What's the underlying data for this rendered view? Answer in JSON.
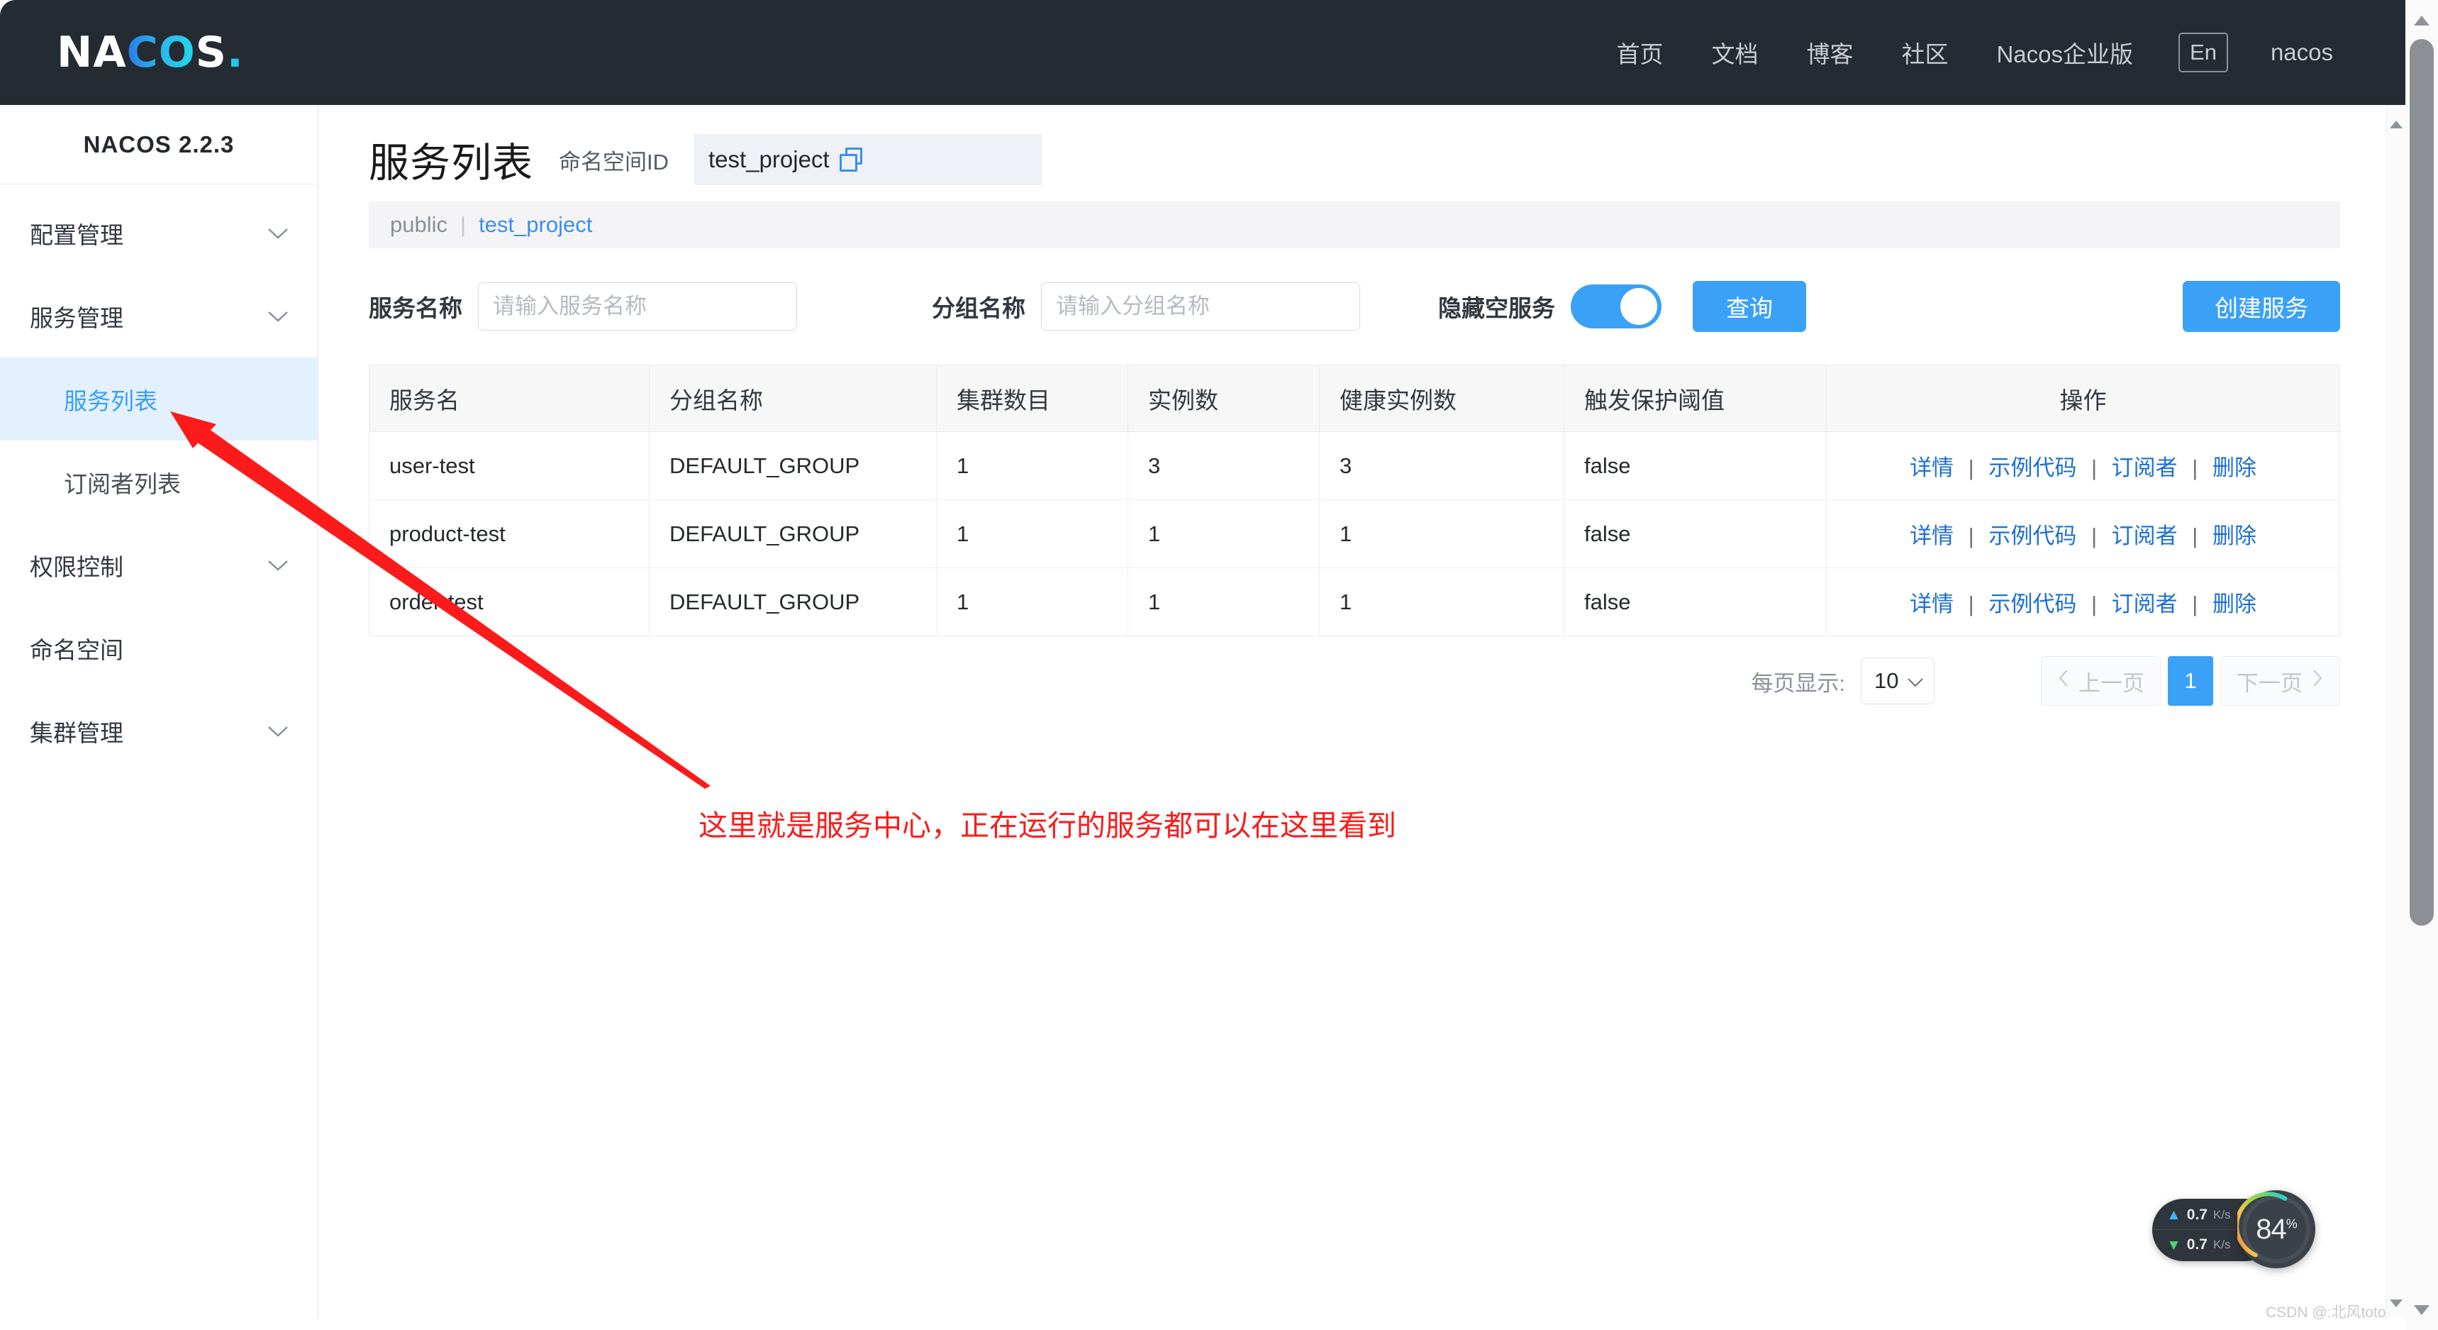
{
  "topnav": {
    "logo": {
      "part1": "NA",
      "part2": "CO",
      "part3": "S",
      "dot": "."
    },
    "items": [
      {
        "label": "首页"
      },
      {
        "label": "文档"
      },
      {
        "label": "博客"
      },
      {
        "label": "社区"
      },
      {
        "label": "Nacos企业版"
      }
    ],
    "lang": "En",
    "user": "nacos"
  },
  "sidebar": {
    "title": "NACOS 2.2.3",
    "items": [
      {
        "label": "配置管理",
        "type": "group",
        "expandable": true
      },
      {
        "label": "服务管理",
        "type": "group",
        "expandable": true
      },
      {
        "label": "服务列表",
        "type": "sub",
        "active": true
      },
      {
        "label": "订阅者列表",
        "type": "sub",
        "active": false
      },
      {
        "label": "权限控制",
        "type": "group",
        "expandable": true
      },
      {
        "label": "命名空间",
        "type": "group",
        "expandable": false
      },
      {
        "label": "集群管理",
        "type": "group",
        "expandable": true
      }
    ]
  },
  "page": {
    "title": "服务列表",
    "namespace_label": "命名空间ID",
    "namespace_value": "test_project",
    "copy_icon": "copy-icon",
    "breadcrumb": {
      "root": "public",
      "separator": "|",
      "current": "test_project"
    }
  },
  "filters": {
    "service_name_label": "服务名称",
    "service_name_placeholder": "请输入服务名称",
    "service_name_value": "",
    "group_name_label": "分组名称",
    "group_name_placeholder": "请输入分组名称",
    "group_name_value": "",
    "hide_empty_label": "隐藏空服务",
    "hide_empty_on": true,
    "query_button": "查询",
    "create_button": "创建服务"
  },
  "table": {
    "headers": [
      "服务名",
      "分组名称",
      "集群数目",
      "实例数",
      "健康实例数",
      "触发保护阈值",
      "操作"
    ],
    "rows": [
      {
        "service": "user-test",
        "group": "DEFAULT_GROUP",
        "clusters": "1",
        "instances": "3",
        "healthy": "3",
        "threshold": "false",
        "actions": [
          "详情",
          "示例代码",
          "订阅者",
          "删除"
        ]
      },
      {
        "service": "product-test",
        "group": "DEFAULT_GROUP",
        "clusters": "1",
        "instances": "1",
        "healthy": "1",
        "threshold": "false",
        "actions": [
          "详情",
          "示例代码",
          "订阅者",
          "删除"
        ]
      },
      {
        "service": "order-test",
        "group": "DEFAULT_GROUP",
        "clusters": "1",
        "instances": "1",
        "healthy": "1",
        "threshold": "false",
        "actions": [
          "详情",
          "示例代码",
          "订阅者",
          "删除"
        ]
      }
    ]
  },
  "pagination": {
    "page_size_label": "每页显示:",
    "page_size_value": "10",
    "prev_label": "上一页",
    "next_label": "下一页",
    "current_page": "1"
  },
  "annotation": {
    "text": "这里就是服务中心，正在运行的服务都可以在这里看到",
    "color": "#fb1b1b"
  },
  "float_widget": {
    "upload_value": "0.7",
    "upload_unit": "K/s",
    "download_value": "0.7",
    "download_unit": "K/s",
    "cpu_percent": "84",
    "percent_sign": "%"
  },
  "watermark": "CSDN @:北风toto",
  "colors": {
    "accent": "#3ba1f7",
    "link": "#1c6fd4",
    "nav_bg": "#252b33",
    "active_bg": "#e3f0fd",
    "annotation": "#fb1b1b"
  }
}
